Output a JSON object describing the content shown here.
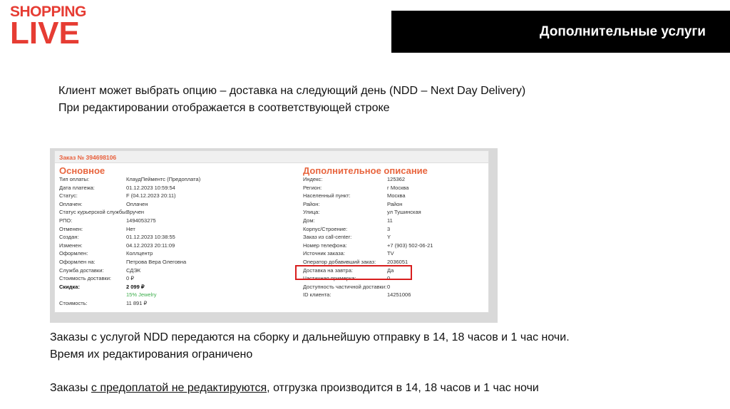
{
  "logo": {
    "line1": "SHOPPING",
    "line2": "LIVE"
  },
  "header": {
    "title": "Дополнительные услуги"
  },
  "intro": {
    "line1": "Клиент может выбрать опцию – доставка на следующий день (NDD – Next Day Delivery)",
    "line2": "При редактировании  отображается в соответствующей строке"
  },
  "screenshot": {
    "order_number": "Заказ № 394698106",
    "left_title": "Основное",
    "right_title": "Дополнительное описание",
    "left_rows": [
      {
        "key": "Тип оплаты:",
        "value": "КлаудПейментс (Предоплата)"
      },
      {
        "key": "Дата платежа:",
        "value": "01.12.2023 10:59:54"
      },
      {
        "key": "Статус:",
        "value": "F (04.12.2023 20:11)"
      },
      {
        "key": "Оплачен:",
        "value": "Оплачен"
      },
      {
        "key": "Статус курьерской службы:",
        "value": "Вручен"
      },
      {
        "key": "РПО:",
        "value": "1494053275"
      },
      {
        "key": "Отменен:",
        "value": "Нет"
      },
      {
        "key": "Создан:",
        "value": "01.12.2023 10:38:55"
      },
      {
        "key": "Изменен:",
        "value": "04.12.2023 20:11:09"
      },
      {
        "key": "Оформлен:",
        "value": "Коллцентр"
      },
      {
        "key": "Оформлен на:",
        "value": "Петрова Вера Олеговна"
      },
      {
        "key": "Служба доставки:",
        "value": "СДЭК"
      },
      {
        "key": "Стоимость доставки:",
        "value": "0 ₽"
      },
      {
        "key": "Скидка:",
        "value": "2 099 ₽"
      },
      {
        "key": "",
        "value": "15% Jewelry"
      },
      {
        "key": "Стоимость:",
        "value": "11 891 ₽"
      }
    ],
    "right_rows": [
      {
        "key": "Индекс:",
        "value": "125362"
      },
      {
        "key": "Регион:",
        "value": "г Москва"
      },
      {
        "key": "Населенный пункт:",
        "value": "Москва"
      },
      {
        "key": "Район:",
        "value": "Район"
      },
      {
        "key": "Улица:",
        "value": "ул Тушинская"
      },
      {
        "key": "Дом:",
        "value": "11"
      },
      {
        "key": "Корпус/Строение:",
        "value": "3"
      },
      {
        "key": "Заказ из call-center:",
        "value": "Y"
      },
      {
        "key": "Номер телефона:",
        "value": "+7 (903) 502-06-21"
      },
      {
        "key": "Источник заказа:",
        "value": "TV"
      },
      {
        "key": "Оператор добавивший заказ:",
        "value": "2036051"
      },
      {
        "key": "Доставка на завтра:",
        "value": "Да"
      },
      {
        "key": "Частичная примерка:",
        "value": "0"
      },
      {
        "key": "Доступность частичной доставки:",
        "value": "0"
      },
      {
        "key": "ID клиента:",
        "value": "14251006"
      }
    ]
  },
  "para2": {
    "line1": "Заказы с услугой NDD передаются на сборку и дальнейшую отправку в 14, 18 часов и 1 час ночи.",
    "line2": "Время их редактирования ограничено"
  },
  "para3": {
    "prefix": "Заказы ",
    "underlined": "с предоплатой не редактируются",
    "suffix": ", отгрузка производится в 14, 18 часов и 1 час ночи"
  }
}
